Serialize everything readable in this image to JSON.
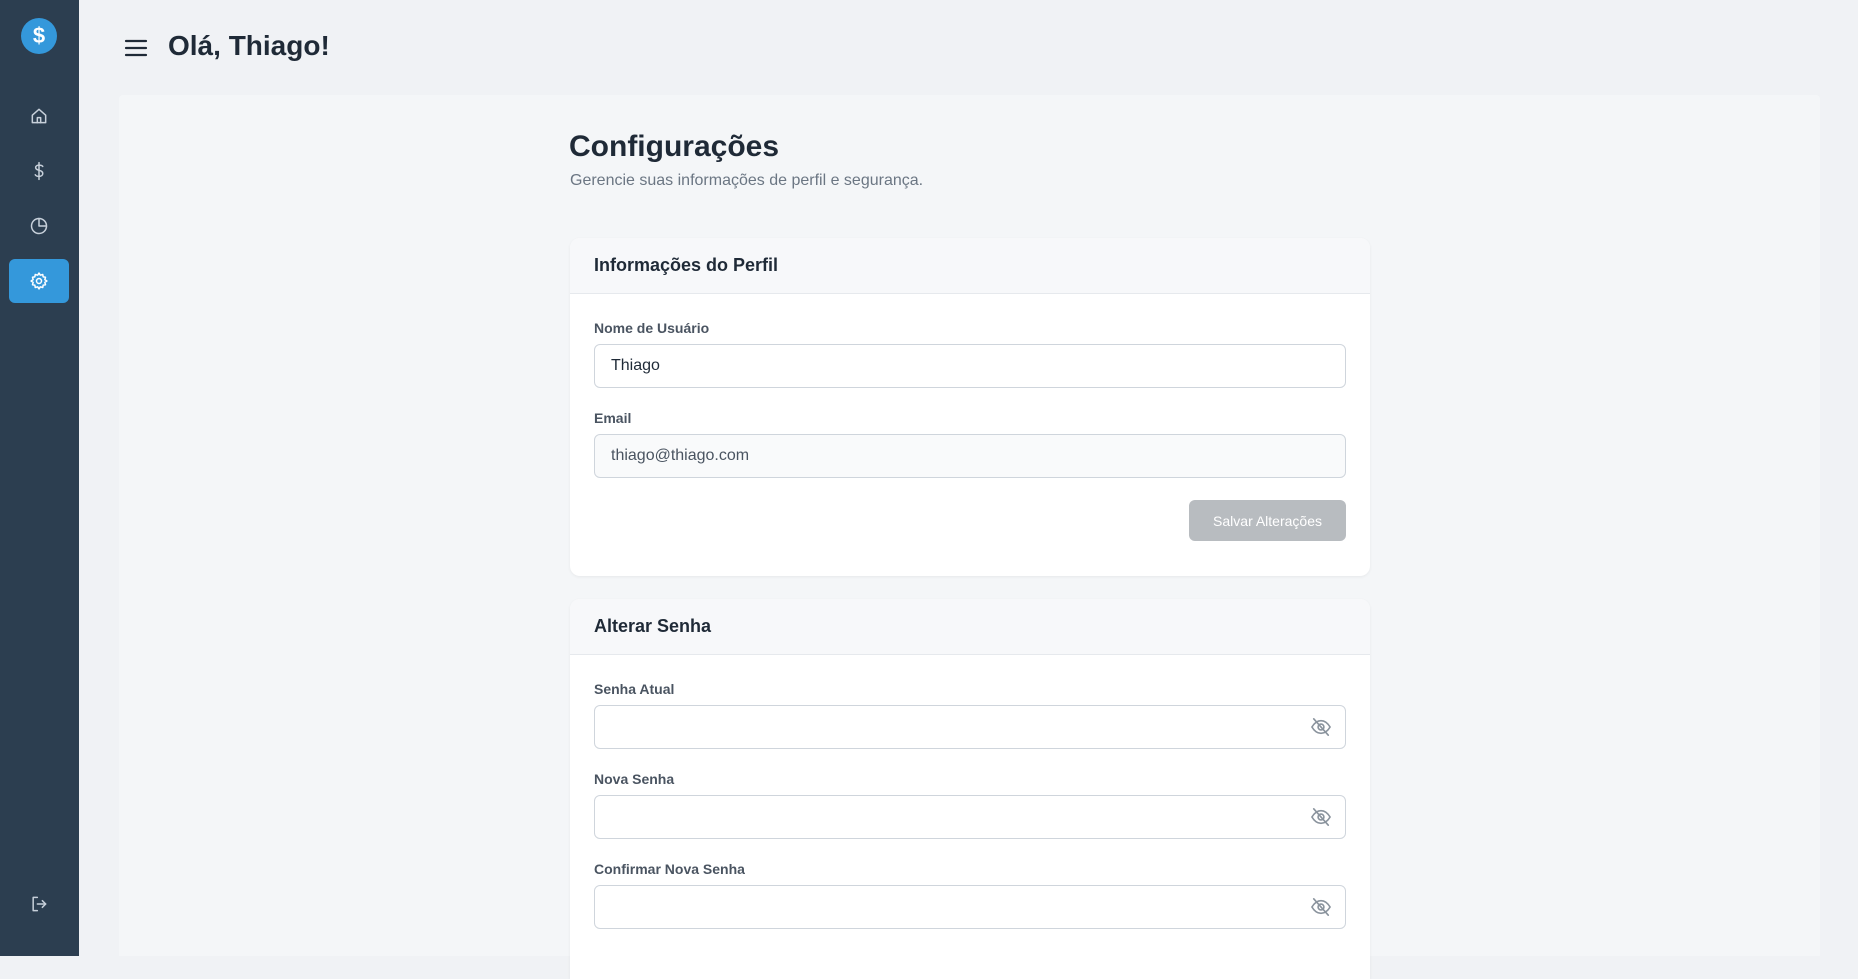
{
  "header": {
    "greeting": "Olá, Thiago!"
  },
  "sidebar": {
    "logo_symbol": "$",
    "items": [
      {
        "name": "home",
        "icon": "home-icon"
      },
      {
        "name": "transactions",
        "icon": "dollar-icon"
      },
      {
        "name": "reports",
        "icon": "pie-chart-icon"
      },
      {
        "name": "settings",
        "icon": "gear-icon",
        "active": true
      }
    ],
    "logout_icon": "logout-icon"
  },
  "page": {
    "title": "Configurações",
    "subtitle": "Gerencie suas informações de perfil e segurança."
  },
  "profile_card": {
    "title": "Informações do Perfil",
    "username_label": "Nome de Usuário",
    "username_value": "Thiago",
    "email_label": "Email",
    "email_value": "thiago@thiago.com",
    "save_label": "Salvar Alterações"
  },
  "password_card": {
    "title": "Alterar Senha",
    "current_label": "Senha Atual",
    "current_value": "",
    "new_label": "Nova Senha",
    "new_value": "",
    "confirm_label": "Confirmar Nova Senha",
    "confirm_value": ""
  },
  "colors": {
    "sidebar": "#2c3e50",
    "accent": "#3498db",
    "background": "#f0f2f5",
    "disabled_button": "#b8bcc0"
  }
}
